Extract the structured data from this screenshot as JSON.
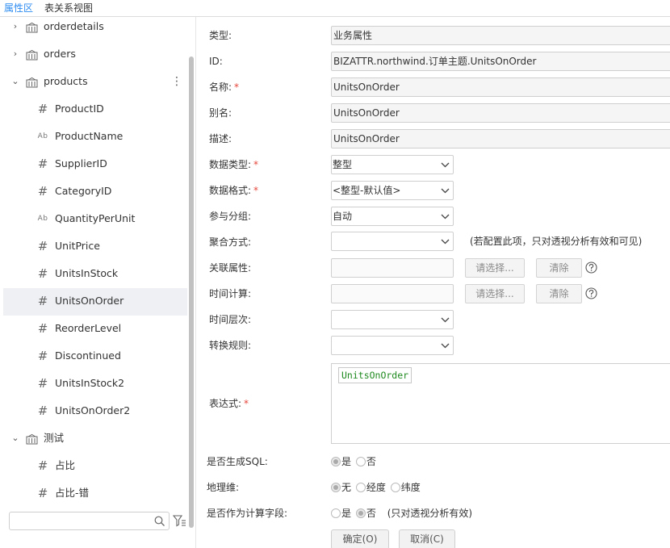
{
  "tabs": [
    {
      "label": "属性区",
      "active": true
    },
    {
      "label": "表关系视图",
      "active": false
    }
  ],
  "tree": {
    "rows": [
      {
        "kind": "table",
        "label": "orderdetails",
        "expanded": false,
        "arrow": "›"
      },
      {
        "kind": "table",
        "label": "orders",
        "expanded": false,
        "arrow": "›"
      },
      {
        "kind": "table",
        "label": "products",
        "expanded": true,
        "arrow": "⌄",
        "more": "⋮"
      },
      {
        "kind": "field",
        "type": "number",
        "icon": "#",
        "label": "ProductID"
      },
      {
        "kind": "field",
        "type": "text",
        "icon": "Ab",
        "label": "ProductName"
      },
      {
        "kind": "field",
        "type": "number",
        "icon": "#",
        "label": "SupplierID"
      },
      {
        "kind": "field",
        "type": "number",
        "icon": "#",
        "label": "CategoryID"
      },
      {
        "kind": "field",
        "type": "text",
        "icon": "Ab",
        "label": "QuantityPerUnit"
      },
      {
        "kind": "field",
        "type": "number",
        "icon": "#",
        "label": "UnitPrice"
      },
      {
        "kind": "field",
        "type": "number",
        "icon": "#",
        "label": "UnitsInStock"
      },
      {
        "kind": "field",
        "type": "number",
        "icon": "#",
        "label": "UnitsOnOrder",
        "selected": true
      },
      {
        "kind": "field",
        "type": "number",
        "icon": "#",
        "label": "ReorderLevel"
      },
      {
        "kind": "field",
        "type": "number",
        "icon": "#",
        "label": "Discontinued"
      },
      {
        "kind": "field",
        "type": "number",
        "icon": "#",
        "label": "UnitsInStock2"
      },
      {
        "kind": "field",
        "type": "number",
        "icon": "#",
        "label": "UnitsOnOrder2"
      },
      {
        "kind": "table",
        "label": "测试",
        "expanded": true,
        "arrow": "⌄"
      },
      {
        "kind": "field",
        "type": "number",
        "icon": "#",
        "label": "占比"
      },
      {
        "kind": "field",
        "type": "number",
        "icon": "#",
        "label": "占比-错"
      }
    ],
    "search": {
      "value": "",
      "placeholder": ""
    },
    "icons": {
      "search": "search-icon",
      "filter": "filter-icon",
      "table": "table-icon"
    }
  },
  "form": {
    "type": {
      "label": "类型:",
      "value": "业务属性"
    },
    "id": {
      "label": "ID:",
      "value": "BIZATTR.northwind.订单主题.UnitsOnOrder"
    },
    "name": {
      "label": "名称:",
      "required": "*",
      "value": "UnitsOnOrder"
    },
    "alias": {
      "label": "别名:",
      "value": "UnitsOnOrder"
    },
    "desc": {
      "label": "描述:",
      "value": "UnitsOnOrder"
    },
    "data_type": {
      "label": "数据类型:",
      "required": "*",
      "value": "整型"
    },
    "data_format": {
      "label": "数据格式:",
      "required": "*",
      "value": "<整型-默认值>"
    },
    "grouping": {
      "label": "参与分组:",
      "value": "自动"
    },
    "aggregation": {
      "label": "聚合方式:",
      "value": "",
      "note": "(若配置此项，只对透视分析有效和可见)"
    },
    "related_attr": {
      "label": "关联属性:",
      "choose_label": "请选择...",
      "clear_label": "清除"
    },
    "time_calc": {
      "label": "时间计算:",
      "choose_label": "请选择...",
      "clear_label": "清除"
    },
    "time_level": {
      "label": "时间层次:",
      "value": ""
    },
    "convert_rule": {
      "label": "转换规则:",
      "value": ""
    },
    "expression": {
      "label": "表达式:",
      "required": "*",
      "token": "UnitsOnOrder"
    },
    "gen_sql": {
      "label": "是否生成SQL:",
      "options": [
        "是",
        "否"
      ],
      "selected": 0
    },
    "geo_dim": {
      "label": "地理维:",
      "options": [
        "无",
        "经度",
        "纬度"
      ],
      "selected": 0
    },
    "calc_field": {
      "label": "是否作为计算字段:",
      "options": [
        "是",
        "否"
      ],
      "selected": 1,
      "hint": "(只对透视分析有效)"
    }
  },
  "footer": {
    "ok_label": "确定(O)",
    "cancel_label": "取消(C)"
  },
  "colors": {
    "accent": "#2d8cf0",
    "required": "#e5463c",
    "expression_text": "#1f8a1f",
    "selected_row": "#eef0f4"
  }
}
